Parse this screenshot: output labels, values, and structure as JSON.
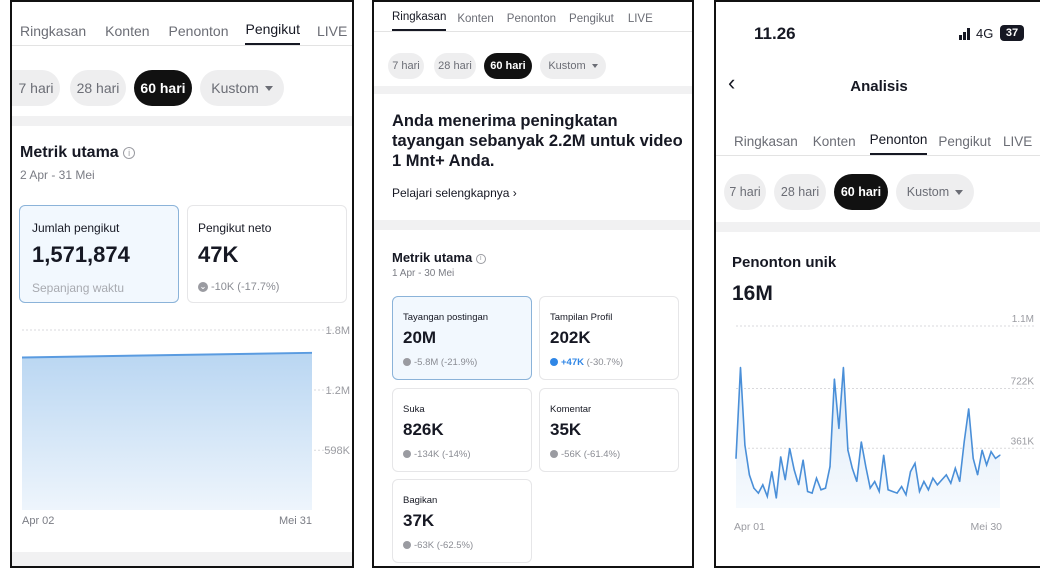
{
  "panel1": {
    "tabs": [
      "Ringkasan",
      "Konten",
      "Penonton",
      "Pengikut",
      "LIVE"
    ],
    "active_tab": "Pengikut",
    "filters": [
      "7 hari",
      "28 hari",
      "60 hari",
      "Kustom"
    ],
    "active_filter": "60 hari",
    "section_title": "Metrik utama",
    "date_range": "2 Apr - 31 Mei",
    "metric_total": {
      "label": "Jumlah pengikut",
      "value": "1,571,874",
      "sub": "Sepanjang waktu"
    },
    "metric_net": {
      "label": "Pengikut neto",
      "value": "47K",
      "delta": "-10K (-17.7%)"
    },
    "chart_data": {
      "type": "area",
      "title": "",
      "x_labels": [
        "Apr 02",
        "Mei 31"
      ],
      "y_ticks": [
        "1.8M",
        "1.2M",
        "598K"
      ],
      "ylim": [
        0,
        1800000
      ],
      "x": [
        "Apr 02",
        "Mei 31"
      ],
      "values": [
        1525000,
        1571874
      ],
      "grid": true
    }
  },
  "panel2": {
    "tabs": [
      "Ringkasan",
      "Konten",
      "Penonton",
      "Pengikut",
      "LIVE"
    ],
    "active_tab": "Ringkasan",
    "filters": [
      "7 hari",
      "28 hari",
      "60 hari",
      "Kustom"
    ],
    "active_filter": "60 hari",
    "banner_text": "Anda menerima peningkatan tayangan sebanyak 2.2M untuk video 1 Mnt+ Anda.",
    "banner_link": "Pelajari selengkapnya",
    "section_title": "Metrik utama",
    "date_range": "1 Apr - 30 Mei",
    "metrics": [
      {
        "label": "Tayangan postingan",
        "value": "20M",
        "delta": "-5.8M (-21.9%)",
        "trend": "down"
      },
      {
        "label": "Tampilan Profil",
        "value": "202K",
        "delta_pos": "+47K",
        "delta_rest": "(-30.7%)",
        "trend": "up"
      },
      {
        "label": "Suka",
        "value": "826K",
        "delta": "-134K (-14%)",
        "trend": "down"
      },
      {
        "label": "Komentar",
        "value": "35K",
        "delta": "-56K (-61.4%)",
        "trend": "down"
      },
      {
        "label": "Bagikan",
        "value": "37K",
        "delta": "-63K (-62.5%)",
        "trend": "down"
      }
    ]
  },
  "panel3": {
    "status_time": "11.26",
    "status_network": "4G",
    "status_battery": "37",
    "header_title": "Analisis",
    "tabs": [
      "Ringkasan",
      "Konten",
      "Penonton",
      "Pengikut",
      "LIVE"
    ],
    "active_tab": "Penonton",
    "filters": [
      "7 hari",
      "28 hari",
      "60 hari",
      "Kustom"
    ],
    "active_filter": "60 hari",
    "section_title": "Penonton unik",
    "total": "16M",
    "chart_data": {
      "type": "line",
      "title": "",
      "x_labels": [
        "Apr 01",
        "Mei 30"
      ],
      "y_ticks": [
        "1.1M",
        "722K",
        "361K"
      ],
      "ylim": [
        0,
        1100000
      ],
      "x": [
        "Apr 01",
        "Apr 02",
        "Apr 03",
        "Apr 04",
        "Apr 05",
        "Apr 06",
        "Apr 07",
        "Apr 08",
        "Apr 09",
        "Apr 10",
        "Apr 11",
        "Apr 12",
        "Apr 13",
        "Apr 14",
        "Apr 15",
        "Apr 16",
        "Apr 17",
        "Apr 18",
        "Apr 19",
        "Apr 20",
        "Apr 21",
        "Apr 22",
        "Apr 23",
        "Apr 24",
        "Apr 25",
        "Apr 26",
        "Apr 27",
        "Apr 28",
        "Apr 29",
        "Apr 30",
        "Mei 01",
        "Mei 02",
        "Mei 03",
        "Mei 04",
        "Mei 05",
        "Mei 06",
        "Mei 07",
        "Mei 08",
        "Mei 09",
        "Mei 10",
        "Mei 11",
        "Mei 12",
        "Mei 13",
        "Mei 14",
        "Mei 15",
        "Mei 16",
        "Mei 17",
        "Mei 18",
        "Mei 19",
        "Mei 20",
        "Mei 21",
        "Mei 22",
        "Mei 23",
        "Mei 24",
        "Mei 25",
        "Mei 26",
        "Mei 27",
        "Mei 28",
        "Mei 29",
        "Mei 30"
      ],
      "values": [
        300000,
        850000,
        380000,
        200000,
        120000,
        90000,
        140000,
        70000,
        220000,
        60000,
        310000,
        170000,
        360000,
        230000,
        140000,
        290000,
        100000,
        90000,
        180000,
        110000,
        120000,
        250000,
        780000,
        480000,
        850000,
        350000,
        240000,
        160000,
        400000,
        250000,
        120000,
        160000,
        100000,
        320000,
        110000,
        100000,
        90000,
        130000,
        80000,
        220000,
        270000,
        100000,
        160000,
        110000,
        180000,
        140000,
        170000,
        200000,
        150000,
        240000,
        160000,
        400000,
        600000,
        300000,
        200000,
        350000,
        260000,
        340000,
        300000,
        320000
      ]
    }
  }
}
